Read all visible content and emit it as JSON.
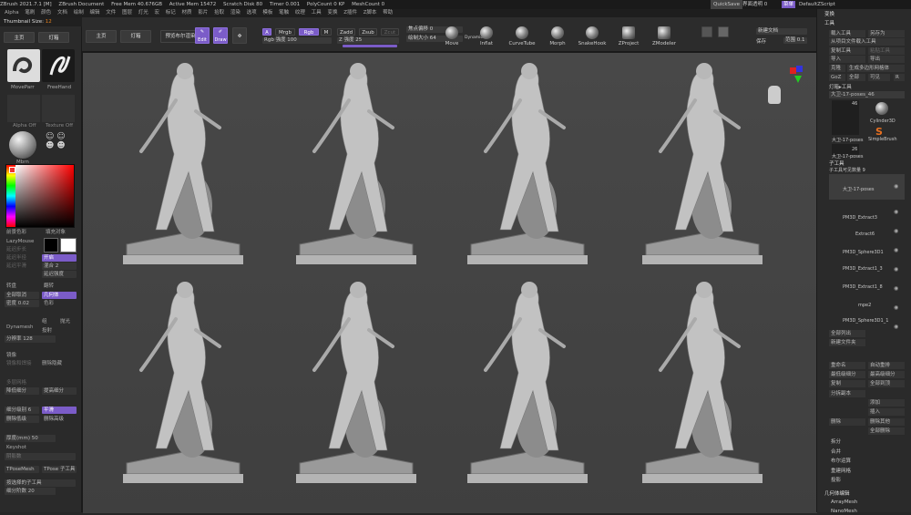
{
  "titlebar": {
    "app": "ZBrush 2021.7.1 [M]",
    "document": "ZBrush Document",
    "free_mem": "Free Mem 40.676GB",
    "active_mem": "Active Mem 15472",
    "scratch": "Scratch Disk 80",
    "timer": "Timer 0.001",
    "polycount": "PolyCount 0 KP",
    "meshcount": "MeshCount 0",
    "quicksave": "QuickSave",
    "transparency": "界面透明 0",
    "menu": "菜单",
    "script": "DefaultZScript"
  },
  "menubar": [
    "Alpha",
    "笔刷",
    "颜色",
    "文档",
    "绘制",
    "编辑",
    "文件",
    "图层",
    "灯光",
    "宏",
    "标记",
    "材质",
    "影片",
    "拾取",
    "渲染",
    "选项",
    "模板",
    "笔触",
    "纹理",
    "工具",
    "变换",
    "Z插件",
    "Z脚本",
    "帮助"
  ],
  "thumbnail": {
    "label": "Thumbnail Size",
    "value": "12"
  },
  "top": {
    "home": "主页",
    "lightbox": "灯箱",
    "preview_label": "预览布尔渲染",
    "edit": "Edit",
    "draw": "Draw",
    "a": "A",
    "mrgb": "Mrgb",
    "rgb": "Rgb",
    "m": "M",
    "rgb_intensity": "Rgb 强度 100",
    "zadd": "Zadd",
    "zsub": "Zsub",
    "zcut": "Zcut",
    "z_intensity": "Z 强度 25",
    "focal_shift": "焦点偏移 0",
    "draw_size": "绘制大小 64",
    "dynamic": "Dynamic",
    "tools": [
      "Move",
      "Inflat",
      "CurveTube",
      "Morph",
      "SnakeHook",
      "ZProject",
      "ZModeler"
    ],
    "new_doc": "新建文档",
    "save": "保存",
    "range": "范围 0.1"
  },
  "left": {
    "brush1": "MoveParr",
    "brush2": "FreeHand",
    "alpha": "Alpha Off",
    "texture": "Texture Off",
    "material": "Mbrn",
    "switch_color": "SwitchColor",
    "gradient": "Gradient",
    "fg_label": "前景色彩",
    "fill": "填充对象",
    "lazymouse": "LazyMouse",
    "turn_on": "开启",
    "dim1": "延迟步长",
    "dim2": "延迟半径",
    "dim3": "延迟平滑",
    "smooth1": "平滑",
    "smooth2": "混合 2",
    "smooth3": "延迟强度",
    "transp": "转盘",
    "flip": "翻转",
    "all_off": "全部取消",
    "geometry": "几何体",
    "density": "密度 0.02",
    "color_field": "色彩",
    "dynamesh": "Dynamesh",
    "group": "组",
    "polish": "抛光",
    "projection": "投射",
    "res": "分辨率 128",
    "mirror": "镜像",
    "mirror_weld": "镜像和焊接",
    "del_hidden": "删除隐藏",
    "layer": "多层网格",
    "lower": "降低细分",
    "higher": "提高细分",
    "subdiv": "细分级别 6",
    "smooth_sub": "平滑",
    "del_lower": "删除低级",
    "del_higher": "删除高级",
    "thickness": "厚度(mm) 50",
    "keyshot": "Keyshot",
    "shadow": "阴影数",
    "tpose1": "TPoseMesh",
    "tpose2": "TPose 子工具",
    "subtool_btn": "按选择的子工具",
    "subdiv_label": "细分阶数 20"
  },
  "right": {
    "transform": "变换",
    "tool": "工具",
    "load": "载入工具",
    "save_as": "另存为",
    "import_proj": "从项目文件载入工具",
    "copy": "复制工具",
    "paste": "粘贴工具",
    "import": "导入",
    "export": "导出",
    "clone": "克隆",
    "make_polymesh": "生成多边形网格体",
    "goz": "GoZ",
    "all": "全部",
    "visible": "可见",
    "r": "R",
    "lightbox_tools": "灯箱▸工具",
    "current_tool": "大卫-17-poses_46",
    "thumb_label1": "大卫-17-poses",
    "thumb_count": "46",
    "cylinder": "Cylinder3D",
    "simplebrush": "SimpleBrush",
    "thumb_label2": "大卫-17-poses",
    "thumb_count2": "26",
    "subtool": "子工具",
    "visible_count": "子工具可见数量 9",
    "subtools": [
      {
        "name": "大卫-17-poses"
      },
      {
        "name": "PM3D_Extract3"
      },
      {
        "name": "Extract6"
      },
      {
        "name": "PM3D_Sphere3D1"
      },
      {
        "name": "PM3D_Extract1_3"
      },
      {
        "name": "PM3D_Extract1_8"
      },
      {
        "name": "mpe2"
      },
      {
        "name": "PM3D_Sphere3D1_1"
      }
    ],
    "list_all": "全部列出",
    "new_folder": "新建文件夹",
    "rename": "重命名",
    "auto_reorder": "自动重排",
    "all_low": "最低级细分",
    "all_high": "最高级细分",
    "duplicate": "复制",
    "append": "全部到顶",
    "del_sub": "分拆副本",
    "add": "添加",
    "insert": "插入",
    "delete": "删除",
    "del_other": "删除其他",
    "del_all": "全部删除",
    "split": "拆分",
    "merge": "合并",
    "remesh": "布尔运算",
    "project": "重建网格",
    "extract": "投影",
    "geometry_edit": "几何体编辑",
    "arraymesh": "ArrayMesh",
    "nanomesh": "NanoMesh"
  }
}
